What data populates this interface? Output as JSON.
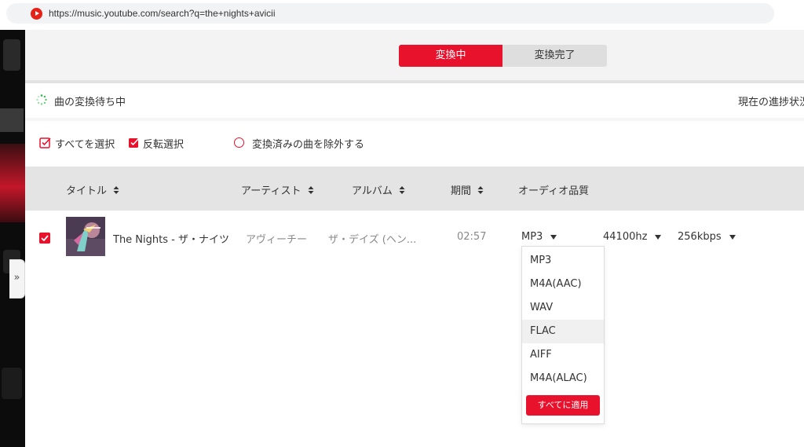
{
  "browser": {
    "url": "https://music.youtube.com/search?q=the+nights+avicii"
  },
  "tabs": {
    "converting": "変換中",
    "completed": "変換完了"
  },
  "status": {
    "waiting_text": "曲の変換待ち中",
    "progress_text": "現在の進捗状況"
  },
  "options": {
    "select_all": "すべてを選択",
    "invert_selection": "反転選択",
    "exclude_converted": "変換済みの曲を除外する"
  },
  "table": {
    "headers": {
      "title": "タイトル",
      "artist": "アーティスト",
      "album": "アルバム",
      "duration": "期間",
      "audio_quality": "オーディオ品質"
    },
    "rows": [
      {
        "checked": true,
        "title": "The Nights - ザ・ナイツ",
        "artist": "アヴィーチー",
        "album": "ザ・デイズ (ヘン...",
        "duration": "02:57",
        "format": "MP3",
        "sample_rate": "44100hz",
        "bitrate": "256kbps"
      }
    ]
  },
  "format_menu": {
    "items": [
      "MP3",
      "M4A(AAC)",
      "WAV",
      "FLAC",
      "AIFF",
      "M4A(ALAC)"
    ],
    "highlighted": "FLAC",
    "apply_all_label": "すべてに適用"
  },
  "colors": {
    "accent": "#e8122d",
    "header_bg": "#e4e4e4",
    "panel_bg": "#f3f3f3"
  },
  "icons": {
    "lock": "lock-icon",
    "youtube_music": "youtube-music-icon",
    "spinner": "loading-spinner-icon",
    "sort": "sort-updown-icon",
    "expand": "double-chevron-right-icon",
    "caret": "caret-down-icon"
  }
}
